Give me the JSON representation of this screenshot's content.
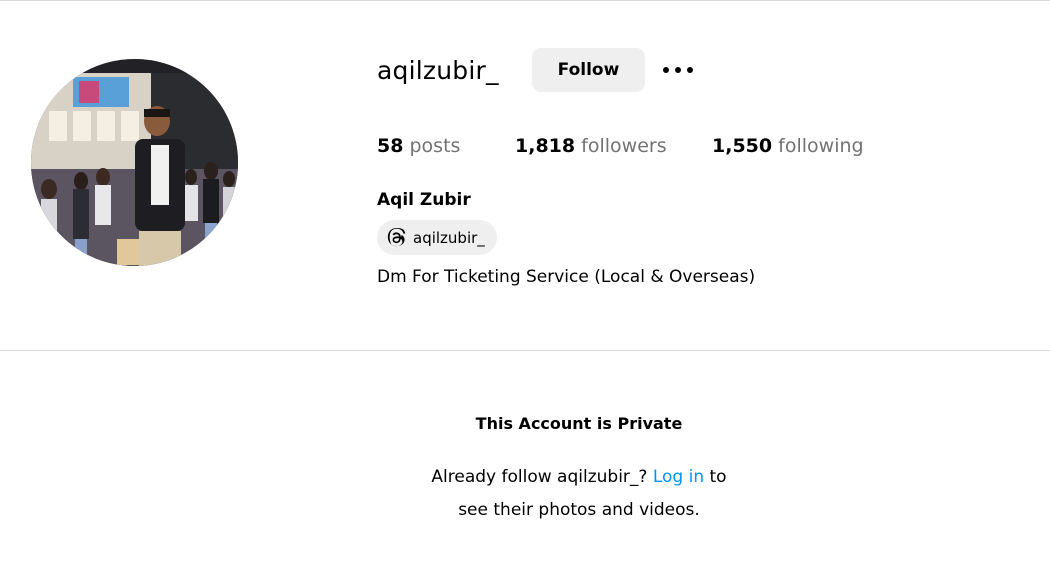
{
  "profile": {
    "username": "aqilzubir_",
    "follow_label": "Follow",
    "more_icon": "more-options-icon",
    "stats": {
      "posts_count": "58",
      "posts_label": "posts",
      "followers_count": "1,818",
      "followers_label": "followers",
      "following_count": "1,550",
      "following_label": "following"
    },
    "full_name": "Aqil Zubir",
    "threads_handle": "aqilzubir_",
    "threads_icon": "threads-icon",
    "bio": "Dm For Ticketing Service (Local & Overseas)"
  },
  "private_notice": {
    "title": "This Account is Private",
    "line1_prefix": "Already follow aqilzubir_?",
    "login_link": "Log in",
    "line1_suffix": "to",
    "line2": "see their photos and videos."
  },
  "colors": {
    "link": "#0095f6",
    "secondary_text": "#737373",
    "button_bg": "#efefef",
    "divider": "#dbdbdb"
  }
}
